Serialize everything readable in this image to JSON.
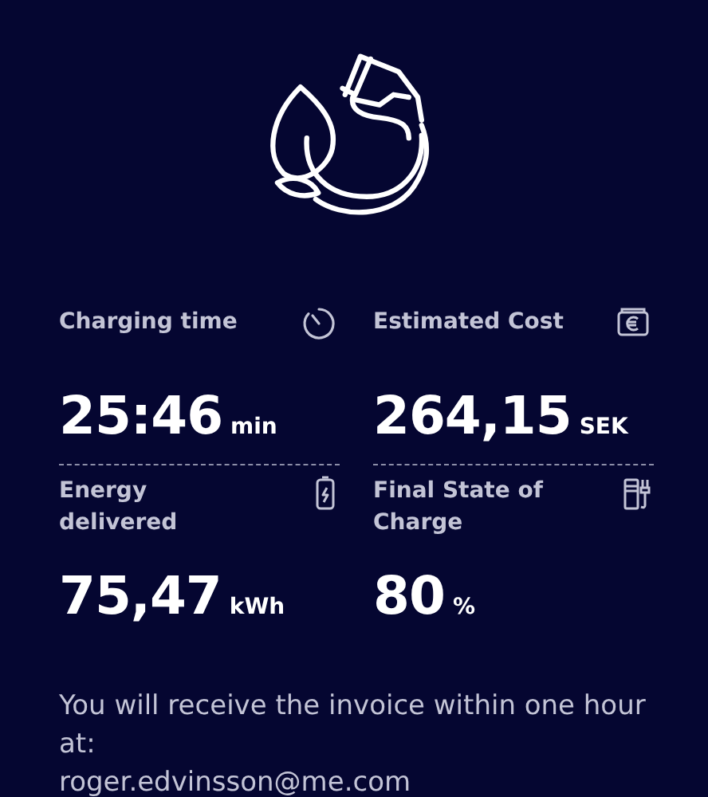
{
  "stats": [
    {
      "kind": "timer",
      "label": "Charging time",
      "value": "25:46",
      "unit": "min"
    },
    {
      "kind": "wallet",
      "label": "Estimated Cost",
      "value": "264,15",
      "unit": "SEK"
    },
    {
      "kind": "battery",
      "label": "Energy delivered",
      "value": "75,47",
      "unit": "kWh"
    },
    {
      "kind": "charger",
      "label": "Final State of Charge",
      "value": "80",
      "unit": "%"
    }
  ],
  "message": {
    "text": "You will receive the invoice within one hour at:",
    "email": "roger.edvinsson@me.com"
  }
}
